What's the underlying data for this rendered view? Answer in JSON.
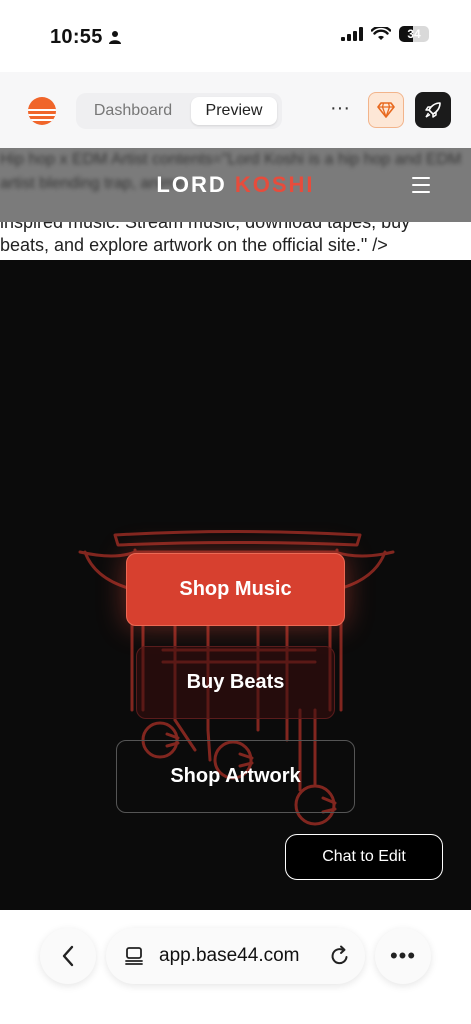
{
  "status_bar": {
    "time": "10:55",
    "battery": "34"
  },
  "app_bar": {
    "tabs": [
      "Dashboard",
      "Preview"
    ],
    "active_tab": "Preview",
    "more_label": "···",
    "brand_color": "#f0652a"
  },
  "site": {
    "logo_primary": "LORD",
    "logo_accent": "KOSHI",
    "accent_color": "#e74c3c",
    "meta_line_1": "inspired music. Stream music, download tapes, buy",
    "meta_line_2": "beats, and explore artwork on the official site.\" />",
    "blurred_meta": "Hip hop x EDM Artist contents=\"Lord Koshi is a hip hop and EDM artist blending trap, anime-"
  },
  "hero": {
    "buttons": [
      {
        "label": "Shop Music"
      },
      {
        "label": "Buy Beats"
      },
      {
        "label": "Shop Artwork"
      }
    ],
    "chat_label": "Chat to Edit"
  },
  "browser": {
    "url": "app.base44.com",
    "menu_label": "•••"
  }
}
